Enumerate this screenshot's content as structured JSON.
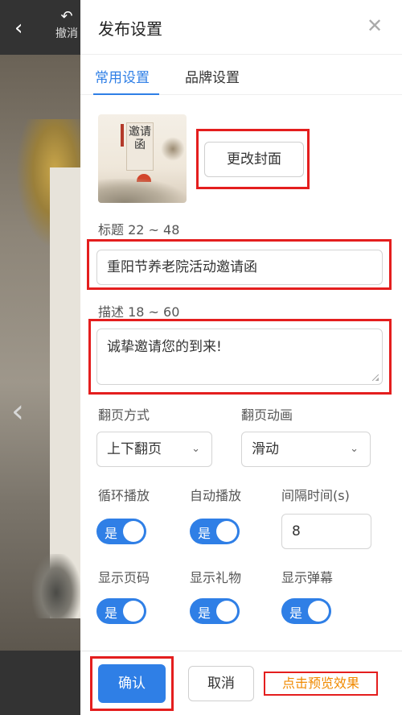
{
  "background": {
    "back_glyph": "‹",
    "undo_label": "撤消",
    "prev_glyph": "‹"
  },
  "panel": {
    "title": "发布设置",
    "close_glyph": "✕"
  },
  "tabs": [
    {
      "label": "常用设置",
      "active": true
    },
    {
      "label": "品牌设置",
      "active": false
    }
  ],
  "cover": {
    "text": "邀请函",
    "change_button": "更改封面"
  },
  "title_field": {
    "label": "标题 22 ~ 48",
    "value": "重阳节养老院活动邀请函"
  },
  "desc_field": {
    "label": "描述 18 ~ 60",
    "value": "诚挚邀请您的到来!"
  },
  "page_turn": {
    "mode_label": "翻页方式",
    "mode_value": "上下翻页",
    "anim_label": "翻页动画",
    "anim_value": "滑动"
  },
  "playback": {
    "loop_label": "循环播放",
    "loop_value": "是",
    "auto_label": "自动播放",
    "auto_value": "是",
    "interval_label": "间隔时间(s)",
    "interval_value": "8"
  },
  "display": {
    "page_num_label": "显示页码",
    "page_num_value": "是",
    "gift_label": "显示礼物",
    "gift_value": "是",
    "danmaku_label": "显示弹幕",
    "danmaku_value": "是"
  },
  "footer": {
    "confirm": "确认",
    "cancel": "取消",
    "preview": "点击预览效果"
  },
  "colors": {
    "accent": "#2f7fe6",
    "highlight_red": "#e41e1e",
    "preview_orange": "#f08a00"
  }
}
